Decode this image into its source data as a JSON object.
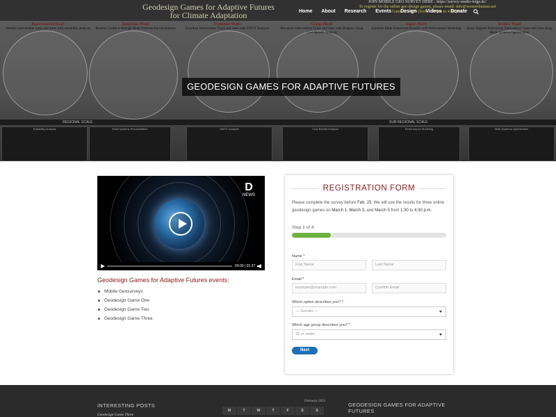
{
  "nav": {
    "items": [
      "Home",
      "About",
      "Research",
      "Events",
      "Design",
      "Videos",
      "Donate"
    ]
  },
  "hero": {
    "title": "GEODESIGN GAMES FOR ADAPTIVE FUTURES",
    "poster": {
      "title_line1": "Geodesign Games for Adaptive Futures",
      "title_line2": "for Climate Adaptation",
      "right_line1": "JOIN MOBILE GEO SURVEY HERE : https://survey-studio-tetge.dc/",
      "right_line2": "To register for the online geo design games, please email: info@weneerhuman.net",
      "right_line3": "Game 1, 3 & 5 (from 1:30 pm to 4:30 pm)",
      "models": [
        {
          "name": "Representation Model",
          "desc": "Identify intervention types and areas with suitability analysis"
        },
        {
          "name": "Integration Model",
          "desc": "Resolve Conflicts through Multi-Systems Reconciliations"
        },
        {
          "name": "Evaluation Model",
          "desc": "Prioritize Intervention Types and Sites with SWOT Analysis"
        },
        {
          "name": "Change Model",
          "desc": "Reconcile Intervention Types and Sites with Budgets Using Cost-Benefit Analysis"
        },
        {
          "name": "Impact Model",
          "desc": "Estimate Multi-Functional Benefits with Performance Modeling"
        },
        {
          "name": "Decision Model",
          "desc": "Select Highest Performing Intervention Types and Sites using Multi-Systems Optimization"
        }
      ],
      "scales": [
        "REGIONAL SCALE",
        "SUB-REGIONAL SCALE"
      ],
      "panels": [
        "Suitability Analysis",
        "Multi-Systems Reconciliation",
        "SWOT Analysis",
        "Cost-Benefit Analysis",
        "Performance Modeling",
        "Multi-Systems Optimization"
      ]
    }
  },
  "video": {
    "time": "00:00 | 01:37",
    "brand": "D",
    "brand_sub": "NEWS"
  },
  "events": {
    "title": "Geodesign Games for Adaptive Futures events:",
    "items": [
      "Mobile Geosurveys",
      "Geodesign Game One",
      "Geodesign Game Two",
      "Geodesign Game Three"
    ]
  },
  "form": {
    "title": "REGISTRATION FORM",
    "intro_pre": "Please complete the survey before ",
    "intro_date": "Feb. 25",
    "intro_mid": ". We will use the results for three online geodesign games on ",
    "d1": "March 1",
    "d2": "March 3",
    "d3": "March 5",
    "intro_from": " from ",
    "t1": "1:30",
    "t2": "4:30 p.m.",
    "step": "Step 1 of 4",
    "progress": 0.25,
    "name_label": "Name",
    "first_placeholder": "First Name",
    "last_placeholder": "Last Name",
    "email_label": "Email",
    "email_placeholder": "example@example.com",
    "confirm_placeholder": "Confirm Email",
    "option_label": "Which option describes you?",
    "option_value": "----Gender----",
    "age_label": "Which age group describes you?",
    "age_value": "18 or under",
    "next": "Next",
    "required": "*"
  },
  "footer": {
    "posts_title": "INTERESTING POSTS",
    "post1": "Geodesign Game Three",
    "calendar_caption": "February 2021",
    "days": [
      "M",
      "T",
      "W",
      "T",
      "F",
      "S",
      "S"
    ],
    "right_title": "GEODESIGN GAMES FOR ADAPTIVE FUTURES"
  },
  "colors": {
    "accent": "#8b1a1a",
    "progress": "#6cb33f",
    "button": "#1f6fb8",
    "footer": "#2b2b2b"
  }
}
